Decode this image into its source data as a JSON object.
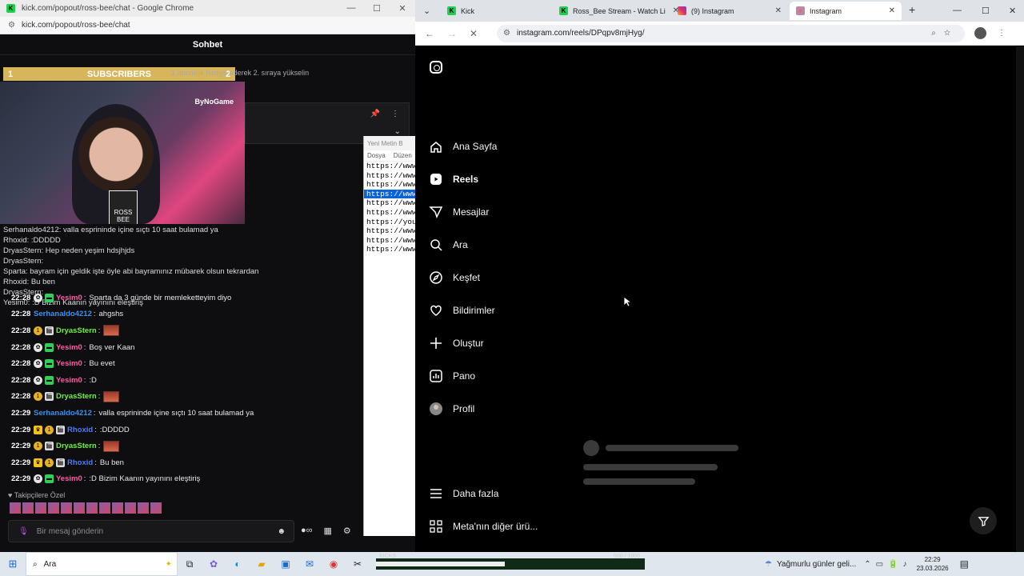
{
  "left_window": {
    "title": "kick.com/popout/ross-bee/chat - Google Chrome",
    "url": "kick.com/popout/ross-bee/chat",
    "chat_header": "Sohbet",
    "subscribers_bar": {
      "rank_left": "1",
      "label": "SUBSCRIBERS",
      "rank_right": "2"
    },
    "gift_note": "1 abonelik hediye ederek 2. sıraya yükselin",
    "webcam_watermark": "ByNoGame",
    "webcam_logo": "ROSS BEE",
    "overlay_lines": [
      "Serhanaldo4212: valla esprininde içine sıçtı 10 saat bulamad ya",
      "Rhoxid: :DDDDD",
      "DryasStern: Hep neden yeşim hdsjhjds",
      "DryasStern:",
      "Sparta: bayram için geldik işte öyle abi bayramınız mübarek olsun tekrardan",
      "Rhoxid: Bu ben",
      "DryasStern:",
      "Yesim0: :D Bizim Kaanın yayınını eleştiriş"
    ],
    "messages": [
      {
        "time": "22:28",
        "badges": [
          "gift",
          "green"
        ],
        "user": "Yesim0",
        "color": "#ff5aa8",
        "text": "Sparta da 3 günde bir memleketteyim diyo",
        "emote": false
      },
      {
        "time": "22:28",
        "badges": [],
        "user": "Serhanaldo4212",
        "color": "#3a8ff0",
        "text": "ahgshs",
        "emote": false
      },
      {
        "time": "22:28",
        "badges": [
          "gold",
          "clap"
        ],
        "user": "DryasStern",
        "color": "#6cf23f",
        "text": "",
        "emote": true
      },
      {
        "time": "22:28",
        "badges": [
          "gift",
          "green"
        ],
        "user": "Yesim0",
        "color": "#ff5aa8",
        "text": "Boş ver Kaan",
        "emote": false
      },
      {
        "time": "22:28",
        "badges": [
          "gift",
          "green"
        ],
        "user": "Yesim0",
        "color": "#ff5aa8",
        "text": "Bu evet",
        "emote": false
      },
      {
        "time": "22:28",
        "badges": [
          "gift",
          "green"
        ],
        "user": "Yesim0",
        "color": "#ff5aa8",
        "text": ":D",
        "emote": false
      },
      {
        "time": "22:28",
        "badges": [
          "gold",
          "clap"
        ],
        "user": "DryasStern",
        "color": "#6cf23f",
        "text": "",
        "emote": true
      },
      {
        "time": "22:29",
        "badges": [],
        "user": "Serhanaldo4212",
        "color": "#3a8ff0",
        "text": "valla esprininde içine sıçtı 10 saat bulamad ya",
        "emote": false
      },
      {
        "time": "22:29",
        "badges": [
          "crown",
          "gold",
          "clap"
        ],
        "user": "Rhoxid",
        "color": "#4e7cff",
        "text": ":DDDDD",
        "emote": false
      },
      {
        "time": "22:29",
        "badges": [
          "gold",
          "clap"
        ],
        "user": "DryasStern",
        "color": "#6cf23f",
        "text": "",
        "emote": true
      },
      {
        "time": "22:29",
        "badges": [
          "crown",
          "gold",
          "clap"
        ],
        "user": "Rhoxid",
        "color": "#4e7cff",
        "text": "Bu ben",
        "emote": false
      },
      {
        "time": "22:29",
        "badges": [
          "gift",
          "green"
        ],
        "user": "Yesim0",
        "color": "#ff5aa8",
        "text": ":D Bizim Kaanın yayınını eleştiriş",
        "emote": false
      }
    ],
    "followers_label": "Takipçilere Özel",
    "chat_placeholder": "Bir mesaj gönderin",
    "notepad": {
      "title": "Yeni Metin B",
      "menu": [
        "Dosya",
        "Düzen"
      ],
      "lines": [
        "https://www.",
        "https://www.",
        "https://www.",
        "https://www.",
        "https://www.",
        "https://www.",
        " https://you",
        "https://www.",
        "https://www.",
        "https://www."
      ],
      "selected_index": 3
    }
  },
  "right_window": {
    "tabs": [
      {
        "label": "Kick",
        "icon": "kick-icon",
        "active": false
      },
      {
        "label": "Ross_Bee Stream - Watch Li",
        "icon": "kick-icon",
        "active": false
      },
      {
        "label": "(9) Instagram",
        "icon": "instagram-icon",
        "active": false
      },
      {
        "label": "Instagram",
        "icon": "instagram-icon",
        "active": true
      }
    ],
    "url": "instagram.com/reels/DPqpv8mjHyg/",
    "nav_items": [
      {
        "label": "Ana Sayfa",
        "icon": "home-icon",
        "bold": false
      },
      {
        "label": "Reels",
        "icon": "reels-icon",
        "bold": true
      },
      {
        "label": "Mesajlar",
        "icon": "messages-icon",
        "bold": false
      },
      {
        "label": "Ara",
        "icon": "search-icon",
        "bold": false
      },
      {
        "label": "Keşfet",
        "icon": "explore-icon",
        "bold": false
      },
      {
        "label": "Bildirimler",
        "icon": "heart-icon",
        "bold": false
      },
      {
        "label": "Oluştur",
        "icon": "plus-icon",
        "bold": false
      },
      {
        "label": "Pano",
        "icon": "dashboard-icon",
        "bold": false
      },
      {
        "label": "Profil",
        "icon": "avatar-icon",
        "bold": false
      }
    ],
    "bottom_items": [
      {
        "label": "Daha fazla",
        "icon": "menu-icon"
      },
      {
        "label": "Meta'nın diğer ürü...",
        "icon": "apps-icon"
      }
    ]
  },
  "taskbar": {
    "search_placeholder": "Ara",
    "progress_label_left": "KICKS",
    "progress_label_right": "500 / 1000",
    "progress_fraction": 0.48,
    "weather": "Yağmurlu günler geli...",
    "time": "22:29",
    "date": "23.03.2026"
  }
}
